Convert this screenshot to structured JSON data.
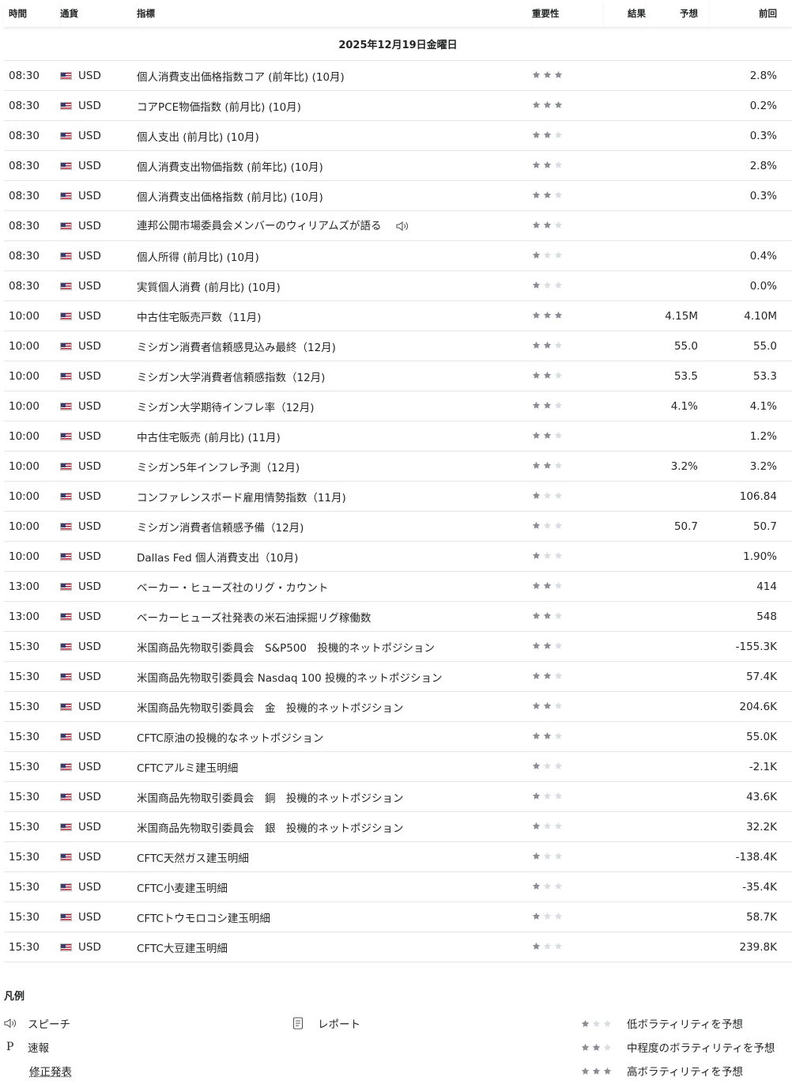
{
  "header": {
    "time": "時間",
    "currency": "通貨",
    "indicator": "指標",
    "importance": "重要性",
    "actual": "結果",
    "forecast": "予想",
    "previous": "前回"
  },
  "date_label": "2025年12月19日金曜日",
  "rows": [
    {
      "time": "08:30",
      "currency": "USD",
      "event": "個人消費支出価格指数コア (前年比) (10月)",
      "stars": 3,
      "actual": "",
      "forecast": "",
      "previous": "2.8%"
    },
    {
      "time": "08:30",
      "currency": "USD",
      "event": "コアPCE物価指数 (前月比) (10月)",
      "stars": 3,
      "actual": "",
      "forecast": "",
      "previous": "0.2%"
    },
    {
      "time": "08:30",
      "currency": "USD",
      "event": "個人支出 (前月比) (10月)",
      "stars": 2,
      "actual": "",
      "forecast": "",
      "previous": "0.3%"
    },
    {
      "time": "08:30",
      "currency": "USD",
      "event": "個人消費支出物価指数 (前年比) (10月)",
      "stars": 2,
      "actual": "",
      "forecast": "",
      "previous": "2.8%"
    },
    {
      "time": "08:30",
      "currency": "USD",
      "event": "個人消費支出価格指数 (前月比) (10月)",
      "stars": 2,
      "actual": "",
      "forecast": "",
      "previous": "0.3%"
    },
    {
      "time": "08:30",
      "currency": "USD",
      "event": "連邦公開市場委員会メンバーのウィリアムズが語る",
      "stars": 2,
      "actual": "",
      "forecast": "",
      "previous": "",
      "speech": true
    },
    {
      "time": "08:30",
      "currency": "USD",
      "event": "個人所得 (前月比) (10月)",
      "stars": 1,
      "actual": "",
      "forecast": "",
      "previous": "0.4%"
    },
    {
      "time": "08:30",
      "currency": "USD",
      "event": "実質個人消費 (前月比) (10月)",
      "stars": 1,
      "actual": "",
      "forecast": "",
      "previous": "0.0%"
    },
    {
      "time": "10:00",
      "currency": "USD",
      "event": "中古住宅販売戸数（11月)",
      "stars": 3,
      "actual": "",
      "forecast": "4.15M",
      "previous": "4.10M"
    },
    {
      "time": "10:00",
      "currency": "USD",
      "event": "ミシガン消費者信頼感見込み最終（12月)",
      "stars": 2,
      "actual": "",
      "forecast": "55.0",
      "previous": "55.0"
    },
    {
      "time": "10:00",
      "currency": "USD",
      "event": "ミシガン大学消費者信頼感指数（12月)",
      "stars": 2,
      "actual": "",
      "forecast": "53.5",
      "previous": "53.3"
    },
    {
      "time": "10:00",
      "currency": "USD",
      "event": "ミシガン大学期待インフレ率（12月)",
      "stars": 2,
      "actual": "",
      "forecast": "4.1%",
      "previous": "4.1%"
    },
    {
      "time": "10:00",
      "currency": "USD",
      "event": "中古住宅販売 (前月比) (11月)",
      "stars": 2,
      "actual": "",
      "forecast": "",
      "previous": "1.2%"
    },
    {
      "time": "10:00",
      "currency": "USD",
      "event": "ミシガン5年インフレ予測（12月)",
      "stars": 2,
      "actual": "",
      "forecast": "3.2%",
      "previous": "3.2%"
    },
    {
      "time": "10:00",
      "currency": "USD",
      "event": "コンファレンスボード雇用情勢指数（11月)",
      "stars": 1,
      "actual": "",
      "forecast": "",
      "previous": "106.84"
    },
    {
      "time": "10:00",
      "currency": "USD",
      "event": "ミシガン消費者信頼感予備（12月)",
      "stars": 1,
      "actual": "",
      "forecast": "50.7",
      "previous": "50.7"
    },
    {
      "time": "10:00",
      "currency": "USD",
      "event": "Dallas Fed 個人消費支出（10月)",
      "stars": 1,
      "actual": "",
      "forecast": "",
      "previous": "1.90%"
    },
    {
      "time": "13:00",
      "currency": "USD",
      "event": "ベーカー・ヒューズ社のリグ・カウント",
      "stars": 2,
      "actual": "",
      "forecast": "",
      "previous": "414"
    },
    {
      "time": "13:00",
      "currency": "USD",
      "event": "ベーカーヒューズ社発表の米石油採掘リグ稼働数",
      "stars": 2,
      "actual": "",
      "forecast": "",
      "previous": "548"
    },
    {
      "time": "15:30",
      "currency": "USD",
      "event": "米国商品先物取引委員会　S&P500　投機的ネットポジション",
      "stars": 2,
      "actual": "",
      "forecast": "",
      "previous": "-155.3K"
    },
    {
      "time": "15:30",
      "currency": "USD",
      "event": "米国商品先物取引委員会 Nasdaq 100 投機的ネットポジション",
      "stars": 2,
      "actual": "",
      "forecast": "",
      "previous": "57.4K"
    },
    {
      "time": "15:30",
      "currency": "USD",
      "event": "米国商品先物取引委員会　金　投機的ネットポジション",
      "stars": 2,
      "actual": "",
      "forecast": "",
      "previous": "204.6K"
    },
    {
      "time": "15:30",
      "currency": "USD",
      "event": "CFTC原油の投機的なネットポジション",
      "stars": 2,
      "actual": "",
      "forecast": "",
      "previous": "55.0K"
    },
    {
      "time": "15:30",
      "currency": "USD",
      "event": "CFTCアルミ建玉明細",
      "stars": 1,
      "actual": "",
      "forecast": "",
      "previous": "-2.1K"
    },
    {
      "time": "15:30",
      "currency": "USD",
      "event": "米国商品先物取引委員会　銅　投機的ネットポジション",
      "stars": 1,
      "actual": "",
      "forecast": "",
      "previous": "43.6K"
    },
    {
      "time": "15:30",
      "currency": "USD",
      "event": "米国商品先物取引委員会　銀　投機的ネットポジション",
      "stars": 1,
      "actual": "",
      "forecast": "",
      "previous": "32.2K"
    },
    {
      "time": "15:30",
      "currency": "USD",
      "event": "CFTC天然ガス建玉明細",
      "stars": 1,
      "actual": "",
      "forecast": "",
      "previous": "-138.4K"
    },
    {
      "time": "15:30",
      "currency": "USD",
      "event": "CFTC小麦建玉明細",
      "stars": 1,
      "actual": "",
      "forecast": "",
      "previous": "-35.4K"
    },
    {
      "time": "15:30",
      "currency": "USD",
      "event": "CFTCトウモロコシ建玉明細",
      "stars": 1,
      "actual": "",
      "forecast": "",
      "previous": "58.7K"
    },
    {
      "time": "15:30",
      "currency": "USD",
      "event": "CFTC大豆建玉明細",
      "stars": 1,
      "actual": "",
      "forecast": "",
      "previous": "239.8K"
    }
  ],
  "legend": {
    "title": "凡例",
    "speech": "スピーチ",
    "report": "レポート",
    "preliminary_icon": "P",
    "preliminary": "速報",
    "revised": "修正発表",
    "low_vol": "低ボラティリティを予想",
    "mid_vol": "中程度のボラティリティを予想",
    "high_vol": "高ボラティリティを予想"
  },
  "colors": {
    "star_filled": "#8a8e94",
    "star_empty": "#dadde1",
    "text": "#232526",
    "divider": "#e6e6e6"
  },
  "icons": {
    "flag": "us-flag-icon",
    "speech": "speaker-icon",
    "report": "document-icon",
    "star": "star-icon"
  }
}
